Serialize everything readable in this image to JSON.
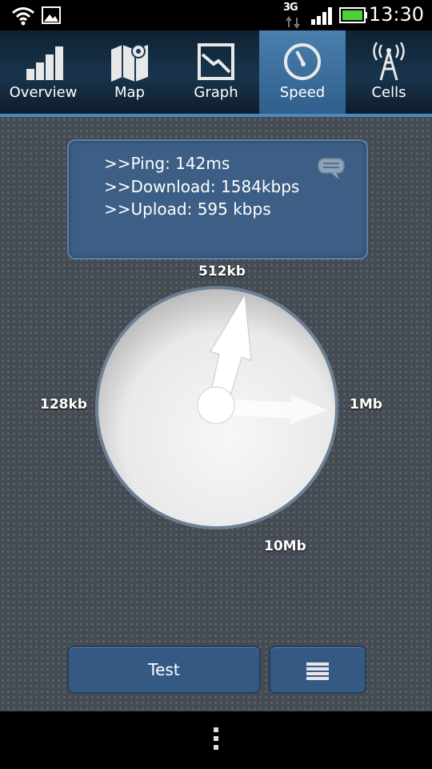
{
  "status_bar": {
    "time": "13:30",
    "network_type": "3G",
    "icons": [
      "wifi-icon",
      "picture-notification-icon",
      "network-3g-icon",
      "signal-strength-icon",
      "battery-icon"
    ]
  },
  "tabs": [
    {
      "label": "Overview",
      "icon": "bar-chart-icon",
      "active": false
    },
    {
      "label": "Map",
      "icon": "map-pin-icon",
      "active": false
    },
    {
      "label": "Graph",
      "icon": "line-graph-icon",
      "active": false
    },
    {
      "label": "Speed",
      "icon": "speedometer-icon",
      "active": true
    },
    {
      "label": "Cells",
      "icon": "cell-tower-icon",
      "active": false
    }
  ],
  "results": {
    "ping": ">>Ping: 142ms",
    "download": ">>Download: 1584kbps",
    "upload": ">>Upload: 595 kbps"
  },
  "gauge": {
    "labels": {
      "top": "512kb",
      "left": "128kb",
      "right": "1Mb",
      "bottom": "10Mb"
    }
  },
  "buttons": {
    "test_label": "Test",
    "list_icon": "list-icon"
  },
  "colors": {
    "accent": "#4a88c2",
    "active_tab": "#3f6f9d",
    "panel": "#3d5f86",
    "background": "#454b53"
  }
}
